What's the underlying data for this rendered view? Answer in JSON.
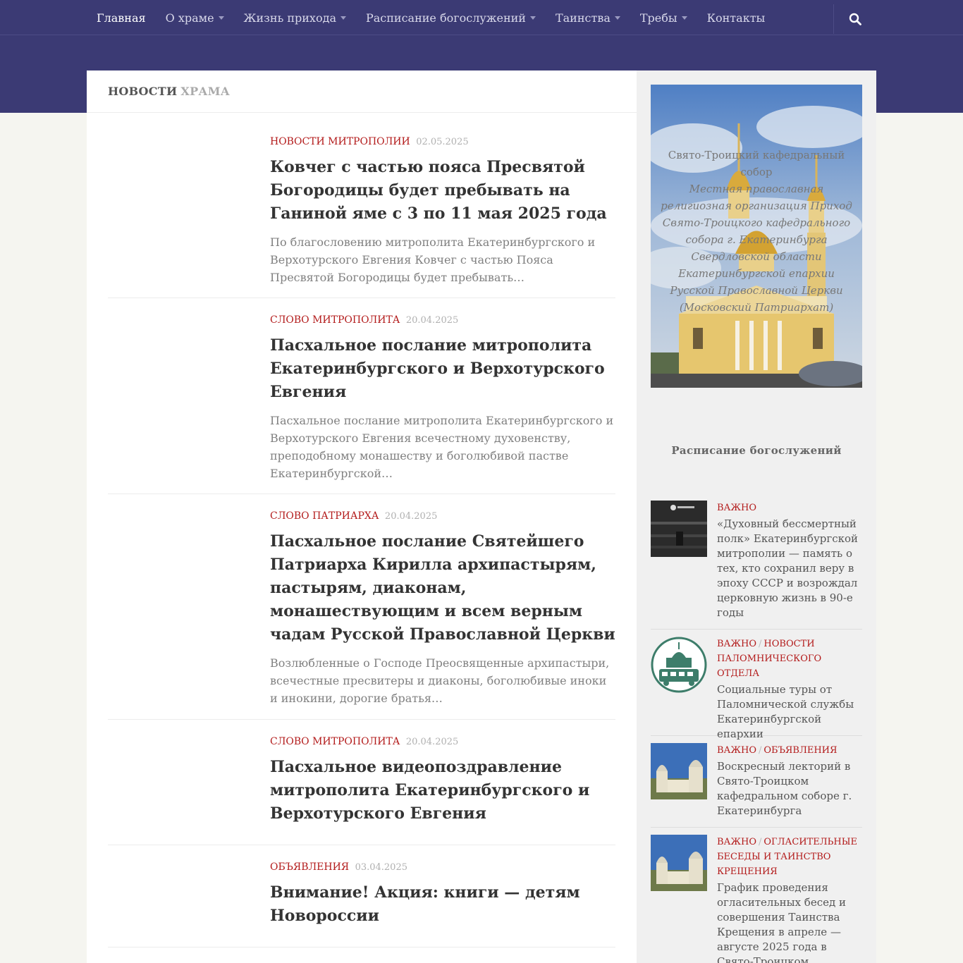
{
  "nav": {
    "items": [
      {
        "label": "Главная",
        "dropdown": false,
        "active": true
      },
      {
        "label": "О храме",
        "dropdown": true
      },
      {
        "label": "Жизнь прихода",
        "dropdown": true
      },
      {
        "label": "Расписание богослужений",
        "dropdown": true
      },
      {
        "label": "Таинства",
        "dropdown": true
      },
      {
        "label": "Требы",
        "dropdown": true
      },
      {
        "label": "Контакты",
        "dropdown": false
      }
    ],
    "search_icon": "search-icon"
  },
  "main": {
    "heading_part1": "НОВОСТИ",
    "heading_part2": "ХРАМА",
    "posts": [
      {
        "category": "НОВОСТИ МИТРОПОЛИИ",
        "date": "02.05.2025",
        "title": "Ковчег с частью пояса Пресвятой Богородицы будет пребывать на Ганиной яме с 3 по 11 мая 2025 года",
        "excerpt": "По благословению митрополита Екатеринбургского и Верхотурского Евгения Ковчег с частью Пояса Пресвятой Богородицы будет пребывать…"
      },
      {
        "category": "СЛОВО МИТРОПОЛИТА",
        "date": "20.04.2025",
        "title": "Пасхальное послание митрополита Екатеринбургского и Верхотурского Евгения",
        "excerpt": "Пасхальное послание митрополита Екатеринбургского и Верхотурского Евгения всечестному духовенству, преподобному монашеству и боголюбивой пастве Екатеринбургской…"
      },
      {
        "category": "СЛОВО ПАТРИАРХА",
        "date": "20.04.2025",
        "title": "Пасхальное послание Святейшего Патриарха Кирилла архипастырям, пастырям, диаконам, монашествующим и всем верным чадам Русской Православной Церкви",
        "excerpt": "Возлюбленные о Господе Преосвященные архипастыри, всечестные пресвитеры и диаконы, боголюбивые иноки и инокини, дорогие братья…"
      },
      {
        "category": "СЛОВО МИТРОПОЛИТА",
        "date": "20.04.2025",
        "title": "Пасхальное видеопоздравление митрополита Екатеринбургского и Верхотурского Евгения",
        "excerpt": ""
      },
      {
        "category": "ОБЪЯВЛЕНИЯ",
        "date": "03.04.2025",
        "title": "Внимание! Акция: книги — детям Новороссии",
        "excerpt": ""
      }
    ]
  },
  "sidebar": {
    "hero": {
      "title": "Свято-Троицкий кафедральный собор",
      "description": "Местная православная религиозная организация Приход Свято-Троицкого кафедрального собора г. Екатеринбурга Свердловской области Екатеринбургской епархии Русской Православной Церкви (Московский Патриархат)"
    },
    "schedule_heading": "Расписание богослужений",
    "items": [
      {
        "categories": [
          "ВАЖНО"
        ],
        "title": "«Духовный бессмертный полк» Екатеринбургской митрополии — память о тех, кто сохранил веру в эпоху СССР и возрождал церковную жизнь в 90-е годы",
        "thumb": "dark-photo"
      },
      {
        "categories": [
          "ВАЖНО",
          "НОВОСТИ ПАЛОМНИЧЕСКОГО ОТДЕЛА"
        ],
        "title": "Социальные туры от Паломнической службы Екатеринбургской епархии",
        "thumb": "pilgrim-logo"
      },
      {
        "categories": [
          "ВАЖНО",
          "ОБЪЯВЛЕНИЯ"
        ],
        "title": "Воскресный лекторий в Свято-Троицком кафедральном соборе г. Екатеринбурга",
        "thumb": "cathedral-photo"
      },
      {
        "categories": [
          "ВАЖНО",
          "ОГЛАСИТЕЛЬНЫЕ БЕСЕДЫ И ТАИНСТВО КРЕЩЕНИЯ"
        ],
        "title": "График проведения огласительных бесед и совершения Таинства Крещения в апреле — августе 2025 года в Свято-Троицком кафедральном соборе",
        "thumb": "cathedral-photo"
      }
    ]
  },
  "colors": {
    "nav_bg": "#3b3a74",
    "category_red": "#b31b1b",
    "page_bg": "#f5f5f0"
  }
}
